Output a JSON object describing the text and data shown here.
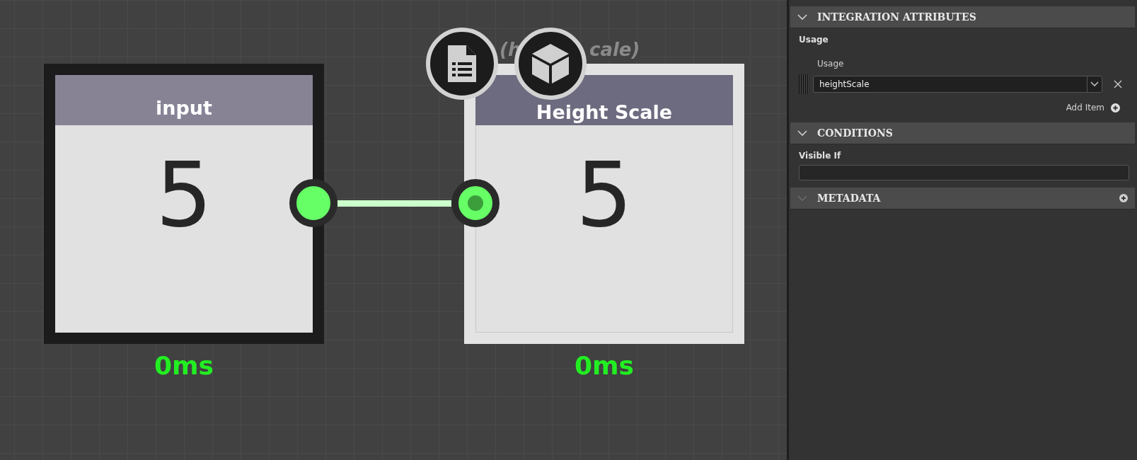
{
  "canvas": {
    "nodes": [
      {
        "kind": "input",
        "title": "input",
        "value": "5",
        "timing": "0ms",
        "port": {
          "kind": "output"
        }
      },
      {
        "kind": "property",
        "title": "Height Scale",
        "value": "5",
        "timing": "0ms",
        "port": {
          "kind": "input"
        },
        "subtitle_fragments": [
          "(h",
          "cale)"
        ]
      }
    ]
  },
  "panel": {
    "sections": [
      {
        "kind": "usage",
        "title": "INTEGRATION ATTRIBUTES",
        "expanded": true,
        "group_label": "Usage",
        "field_label": "Usage",
        "value": "heightScale",
        "add_label": "Add Item"
      },
      {
        "kind": "condition",
        "title": "CONDITIONS",
        "expanded": true,
        "field_label": "Visible If"
      },
      {
        "kind": "metadata",
        "title": "METADATA",
        "expanded": false
      }
    ]
  }
}
